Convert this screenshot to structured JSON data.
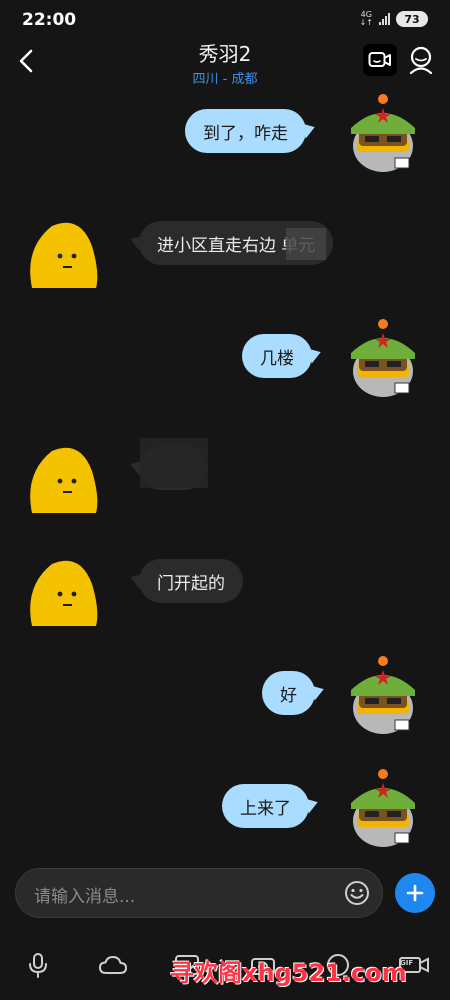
{
  "status_bar": {
    "time": "22:00",
    "network": "4G",
    "battery": "73"
  },
  "header": {
    "title": "秀羽2",
    "subtitle": "四川 - 成都"
  },
  "messages": [
    {
      "dir": "out",
      "text": "到了，咋走"
    },
    {
      "dir": "in",
      "text": "进小区直走右边 单元"
    },
    {
      "dir": "out",
      "text": "几楼"
    },
    {
      "dir": "in",
      "text": ""
    },
    {
      "dir": "in",
      "text": "门开起的"
    },
    {
      "dir": "out",
      "text": "好"
    },
    {
      "dir": "out",
      "text": "上来了"
    }
  ],
  "composer": {
    "placeholder": "请输入消息..."
  },
  "toolbar": {
    "gif_label": "GIF"
  },
  "watermark": "寻欢阁xhg521.com",
  "colors": {
    "accent": "#1e88f0",
    "bubble_out": "#a9dcff",
    "bubble_in": "#2b2b2b",
    "subtitle": "#3f8ee8"
  }
}
